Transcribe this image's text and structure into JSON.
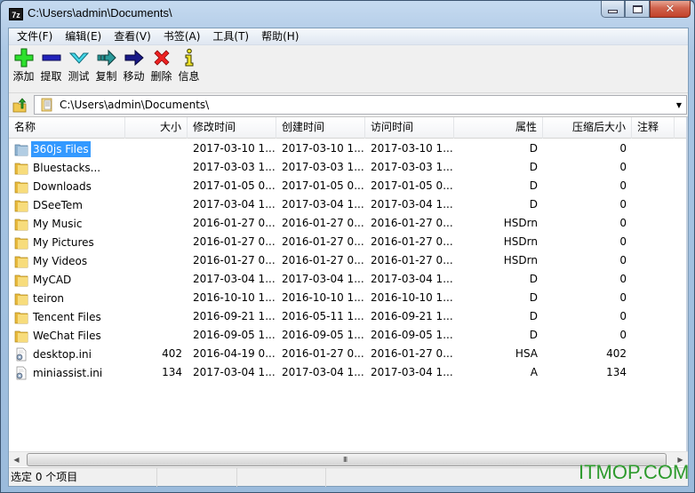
{
  "window": {
    "title": "C:\\Users\\admin\\Documents\\",
    "app_icon_label": "7z",
    "controls": {
      "minimize": "minimize",
      "maximize": "maximize",
      "close": "✕"
    }
  },
  "menu": [
    {
      "label": "文件(F)"
    },
    {
      "label": "编辑(E)"
    },
    {
      "label": "查看(V)"
    },
    {
      "label": "书签(A)"
    },
    {
      "label": "工具(T)"
    },
    {
      "label": "帮助(H)"
    }
  ],
  "toolbar": [
    {
      "label": "添加",
      "icon": "plus-icon",
      "color": "#22cc22"
    },
    {
      "label": "提取",
      "icon": "minus-icon",
      "color": "#1a1aaa"
    },
    {
      "label": "测试",
      "icon": "checkmark-icon",
      "color": "#33ccdd"
    },
    {
      "label": "复制",
      "icon": "copy-arrow-icon",
      "color": "#2a8a8a"
    },
    {
      "label": "移动",
      "icon": "move-arrow-icon",
      "color": "#141478"
    },
    {
      "label": "删除",
      "icon": "delete-x-icon",
      "color": "#e02020"
    },
    {
      "label": "信息",
      "icon": "info-icon",
      "color": "#f0e020"
    }
  ],
  "address": {
    "value": "C:\\Users\\admin\\Documents\\"
  },
  "columns": [
    {
      "label": "名称",
      "align": "left"
    },
    {
      "label": "大小",
      "align": "right"
    },
    {
      "label": "修改时间",
      "align": "left"
    },
    {
      "label": "创建时间",
      "align": "left"
    },
    {
      "label": "访问时间",
      "align": "left"
    },
    {
      "label": "属性",
      "align": "right"
    },
    {
      "label": "压缩后大小",
      "align": "right"
    },
    {
      "label": "注释",
      "align": "left"
    }
  ],
  "rows": [
    {
      "name": "360js Files",
      "type": "folder",
      "size": "",
      "modified": "2017-03-10 1...",
      "created": "2017-03-10 1...",
      "accessed": "2017-03-10 1...",
      "attr": "D",
      "packed": "0",
      "comment": "",
      "selected": true
    },
    {
      "name": "Bluestacks...",
      "type": "folder",
      "size": "",
      "modified": "2017-03-03 1...",
      "created": "2017-03-03 1...",
      "accessed": "2017-03-03 1...",
      "attr": "D",
      "packed": "0",
      "comment": ""
    },
    {
      "name": "Downloads",
      "type": "folder",
      "size": "",
      "modified": "2017-01-05 0...",
      "created": "2017-01-05 0...",
      "accessed": "2017-01-05 0...",
      "attr": "D",
      "packed": "0",
      "comment": ""
    },
    {
      "name": "DSeeTem",
      "type": "folder",
      "size": "",
      "modified": "2017-03-04 1...",
      "created": "2017-03-04 1...",
      "accessed": "2017-03-04 1...",
      "attr": "D",
      "packed": "0",
      "comment": ""
    },
    {
      "name": "My Music",
      "type": "folder",
      "size": "",
      "modified": "2016-01-27 0...",
      "created": "2016-01-27 0...",
      "accessed": "2016-01-27 0...",
      "attr": "HSDrn",
      "packed": "0",
      "comment": ""
    },
    {
      "name": "My Pictures",
      "type": "folder",
      "size": "",
      "modified": "2016-01-27 0...",
      "created": "2016-01-27 0...",
      "accessed": "2016-01-27 0...",
      "attr": "HSDrn",
      "packed": "0",
      "comment": ""
    },
    {
      "name": "My Videos",
      "type": "folder",
      "size": "",
      "modified": "2016-01-27 0...",
      "created": "2016-01-27 0...",
      "accessed": "2016-01-27 0...",
      "attr": "HSDrn",
      "packed": "0",
      "comment": ""
    },
    {
      "name": "MyCAD",
      "type": "folder",
      "size": "",
      "modified": "2017-03-04 1...",
      "created": "2017-03-04 1...",
      "accessed": "2017-03-04 1...",
      "attr": "D",
      "packed": "0",
      "comment": ""
    },
    {
      "name": "teiron",
      "type": "folder",
      "size": "",
      "modified": "2016-10-10 1...",
      "created": "2016-10-10 1...",
      "accessed": "2016-10-10 1...",
      "attr": "D",
      "packed": "0",
      "comment": ""
    },
    {
      "name": "Tencent Files",
      "type": "folder",
      "size": "",
      "modified": "2016-09-21 1...",
      "created": "2016-05-11 1...",
      "accessed": "2016-09-21 1...",
      "attr": "D",
      "packed": "0",
      "comment": ""
    },
    {
      "name": "WeChat Files",
      "type": "folder",
      "size": "",
      "modified": "2016-09-05 1...",
      "created": "2016-09-05 1...",
      "accessed": "2016-09-05 1...",
      "attr": "D",
      "packed": "0",
      "comment": ""
    },
    {
      "name": "desktop.ini",
      "type": "ini",
      "size": "402",
      "modified": "2016-04-19 0...",
      "created": "2016-01-27 0...",
      "accessed": "2016-01-27 0...",
      "attr": "HSA",
      "packed": "402",
      "comment": ""
    },
    {
      "name": "miniassist.ini",
      "type": "ini",
      "size": "134",
      "modified": "2017-03-04 1...",
      "created": "2017-03-04 1...",
      "accessed": "2017-03-04 1...",
      "attr": "A",
      "packed": "134",
      "comment": ""
    }
  ],
  "scrollbar": {
    "grip": "III",
    "left_arrow": "◀",
    "right_arrow": "▶"
  },
  "status": {
    "selection": "选定 0 个项目",
    "pane2": "",
    "pane3": "",
    "pane4": ""
  },
  "watermark": "ITMOP.COM",
  "colors": {
    "selection": "#3399ff",
    "folder": "#f2c94c",
    "folder_selected": "#8fb3d1",
    "watermark": "#2d9a2d"
  }
}
